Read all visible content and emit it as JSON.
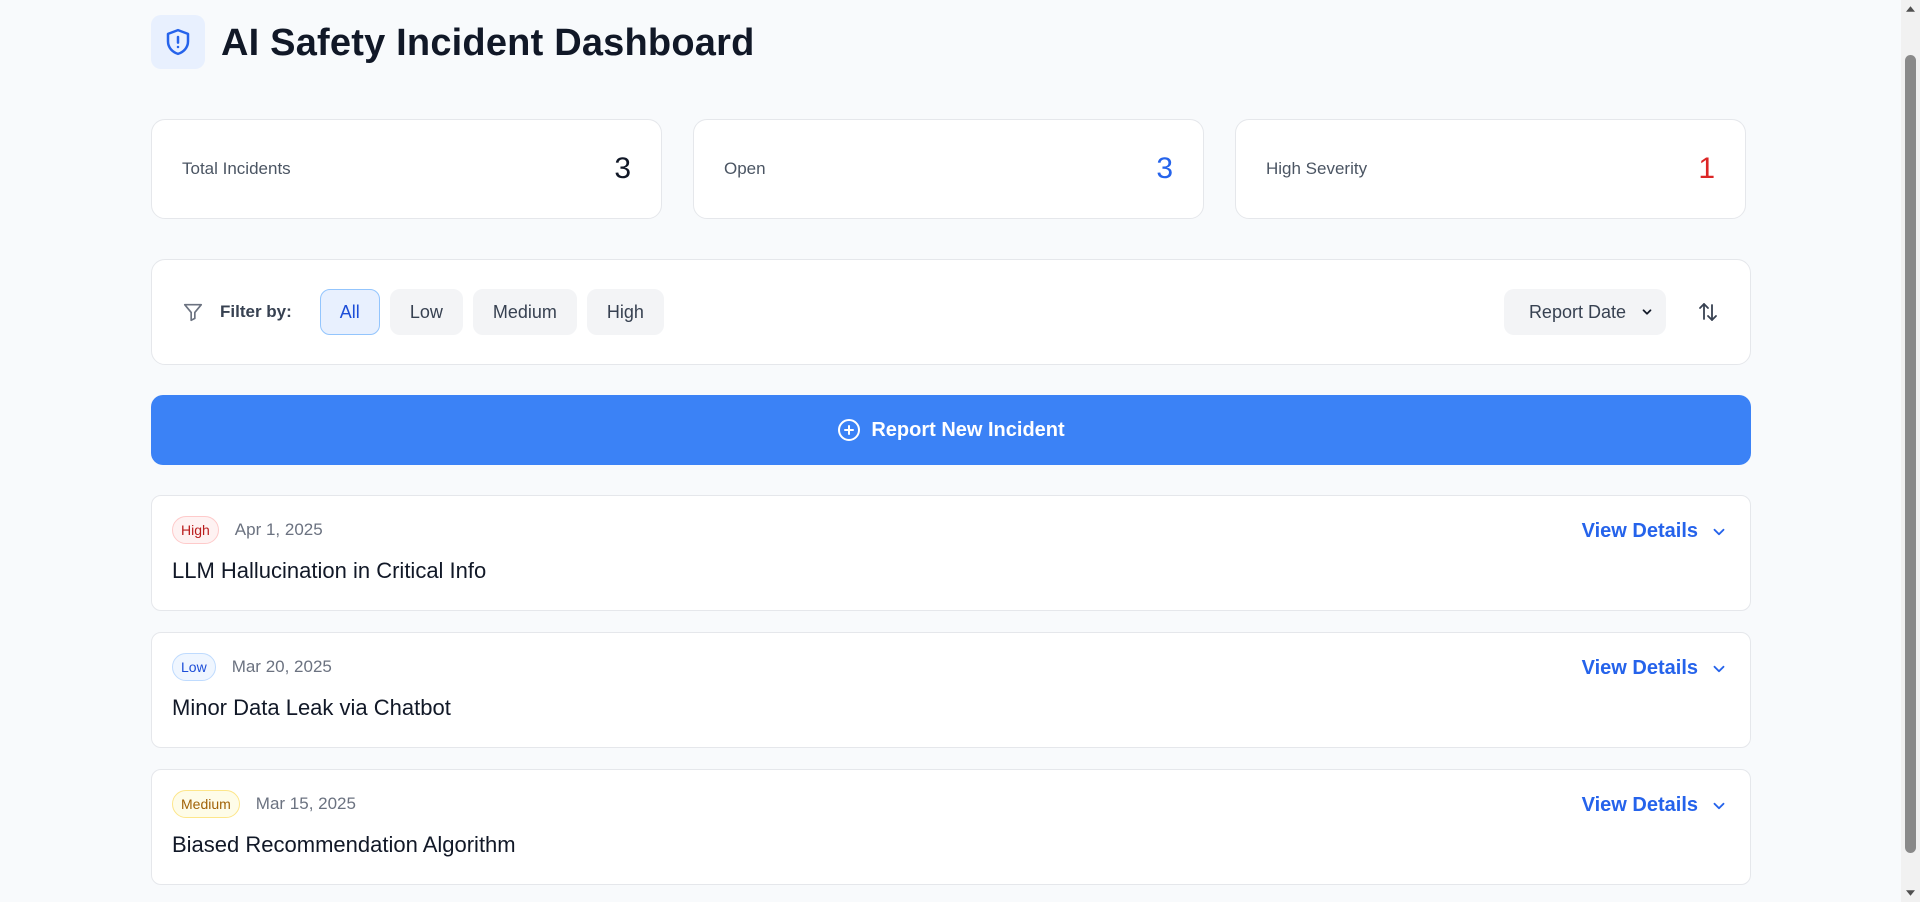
{
  "header": {
    "title": "AI Safety Incident Dashboard",
    "icon": "shield-alert-icon"
  },
  "stats": [
    {
      "label": "Total Incidents",
      "value": "3",
      "color": "#111827"
    },
    {
      "label": "Open",
      "value": "3",
      "color": "#2563eb"
    },
    {
      "label": "High Severity",
      "value": "1",
      "color": "#dc2626"
    }
  ],
  "filters": {
    "label": "Filter by:",
    "options": [
      "All",
      "Low",
      "Medium",
      "High"
    ],
    "active": "All",
    "sort_value": "Report Date"
  },
  "report_button": {
    "label": "Report New Incident"
  },
  "incidents": [
    {
      "severity": "High",
      "date": "Apr 1, 2025",
      "title": "LLM Hallucination in Critical Info",
      "action": "View Details"
    },
    {
      "severity": "Low",
      "date": "Mar 20, 2025",
      "title": "Minor Data Leak via Chatbot",
      "action": "View Details"
    },
    {
      "severity": "Medium",
      "date": "Mar 15, 2025",
      "title": "Biased Recommendation Algorithm",
      "action": "View Details"
    }
  ],
  "colors": {
    "accent": "#3b82f6",
    "link": "#2563eb",
    "background": "#f8fafc"
  }
}
